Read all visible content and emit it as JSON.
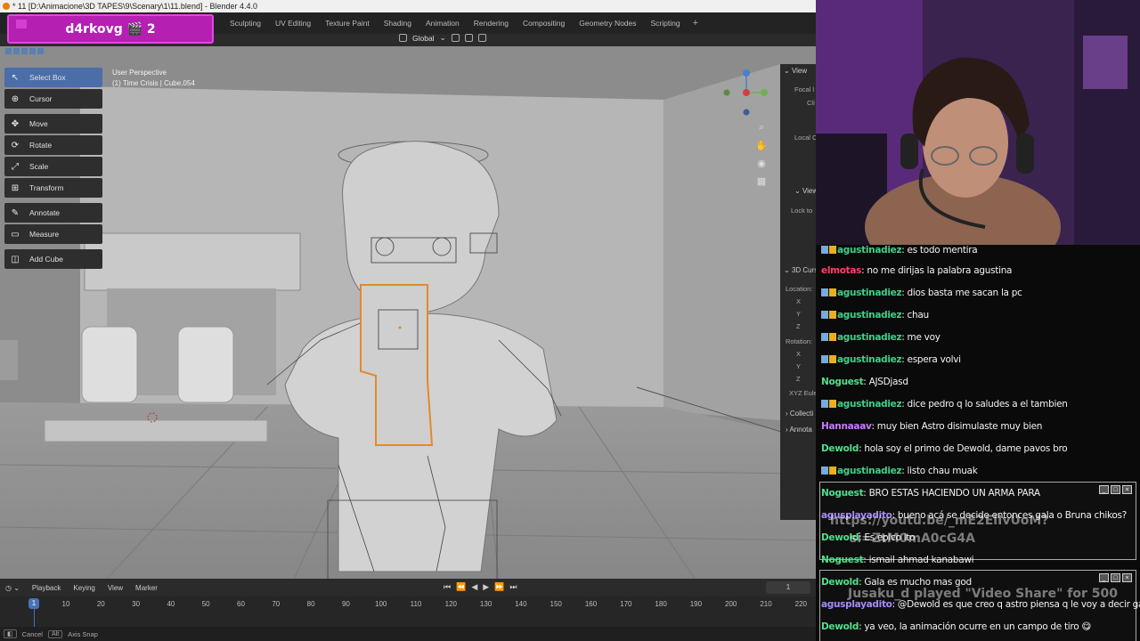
{
  "window": {
    "title": "* 11 [D:\\Animacione\\3D TAPES\\9\\Scenary\\1\\11.blend] - Blender 4.4.0"
  },
  "stream_banner": {
    "text": "d4rkovg 🎬 2"
  },
  "workspaces": [
    "Sculpting",
    "UV Editing",
    "Texture Paint",
    "Shading",
    "Animation",
    "Rendering",
    "Compositing",
    "Geometry Nodes",
    "Scripting"
  ],
  "workspace_add": "+",
  "header": {
    "orientation": "Global"
  },
  "viewport": {
    "perspective": "User Perspective",
    "object": "(1) Time Crisis | Cube.054"
  },
  "toolbar": {
    "items": [
      {
        "label": "Select Box",
        "icon": "cursor-arrow-icon",
        "glyph": "↖",
        "active": true
      },
      {
        "label": "Cursor",
        "icon": "3d-cursor-icon",
        "glyph": "⊕"
      },
      {
        "label": "Move",
        "icon": "move-icon",
        "glyph": "✥"
      },
      {
        "label": "Rotate",
        "icon": "rotate-icon",
        "glyph": "⟳"
      },
      {
        "label": "Scale",
        "icon": "scale-icon",
        "glyph": "⤢"
      },
      {
        "label": "Transform",
        "icon": "transform-icon",
        "glyph": "⊞"
      },
      {
        "label": "Annotate",
        "icon": "pencil-icon",
        "glyph": "✎"
      },
      {
        "label": "Measure",
        "icon": "ruler-icon",
        "glyph": "▭"
      },
      {
        "label": "Add Cube",
        "icon": "cube-icon",
        "glyph": "◫"
      }
    ]
  },
  "npanel": {
    "view_header": "View",
    "focal": "Focal l",
    "clip": "Cli",
    "local": "Local C",
    "view2": "View",
    "lock": "Lock to",
    "cursor3d": "3D Curs",
    "location": "Location:",
    "x": "X",
    "y": "Y",
    "z": "Z",
    "rotation": "Rotation:",
    "euler": "XYZ Eule",
    "collection": "Collecti",
    "annotations": "Annota"
  },
  "timeline": {
    "menus": [
      "Playback",
      "Keying",
      "View",
      "Marker"
    ],
    "current_frame": "1",
    "frame_display": "1",
    "ticks": [
      "10",
      "20",
      "30",
      "40",
      "50",
      "60",
      "70",
      "80",
      "90",
      "100",
      "110",
      "120",
      "130",
      "140",
      "150",
      "160",
      "170",
      "180",
      "190",
      "200",
      "210",
      "220"
    ]
  },
  "statusbar": {
    "cancel": "Cancel",
    "alt": "Alt",
    "snap": "Axis Snap"
  },
  "chat": {
    "messages": [
      {
        "user": "agustinadiez",
        "text": ": es todo mentira",
        "color": "#3fd18a",
        "badges": true
      },
      {
        "user": "elmotas",
        "text": ": no me dirijas la palabra agustina",
        "color": "#ff3f6a",
        "badges": false
      },
      {
        "user": "agustinadiez",
        "text": ": dios basta me sacan la pc",
        "color": "#3fd18a",
        "badges": true
      },
      {
        "user": "agustinadiez",
        "text": ": chau",
        "color": "#3fd18a",
        "badges": true
      },
      {
        "user": "agustinadiez",
        "text": ": me voy",
        "color": "#3fd18a",
        "badges": true
      },
      {
        "user": "agustinadiez",
        "text": ": espera volvi",
        "color": "#3fd18a",
        "badges": true
      },
      {
        "user": "Noguest",
        "text": ": AJSDjasd",
        "color": "#4fe08a",
        "badges": false
      },
      {
        "user": "agustinadiez",
        "text": ": dice pedro q lo saludes a el tambien",
        "color": "#3fd18a",
        "badges": true
      },
      {
        "user": "Hannaaav",
        "text": ": muy bien Astro disimulaste muy bien",
        "color": "#c97bff",
        "badges": false
      },
      {
        "user": "Dewold",
        "text": ": hola soy el primo de Dewold, dame pavos bro",
        "color": "#4fe08a",
        "badges": false
      },
      {
        "user": "agustinadiez",
        "text": ": listo chau muak",
        "color": "#3fd18a",
        "badges": true
      },
      {
        "user": "Noguest",
        "text": ": BRO ESTAS HACIENDO UN ARMA PARA",
        "color": "#4fe08a",
        "badges": false
      },
      {
        "user": "agusplayadito",
        "text": ": bueno acá se decide entonces gala o Bruna chikos?",
        "color": "#a78bfa",
        "badges": false
      },
      {
        "user": "Dewold",
        "text": ": Es epico ito",
        "color": "#4fe08a",
        "badges": false
      },
      {
        "user": "Noguest",
        "text": ": ismail ahmad kanabawi",
        "color": "#4fe08a",
        "badges": false
      },
      {
        "user": "Dewold",
        "text": ": Gala es mucho mas god",
        "color": "#4fe08a",
        "badges": false
      },
      {
        "user": "agusplayadito",
        "text": ": @Dewold es que creo q astro piensa q le voy a decir galati",
        "color": "#a78bfa",
        "badges": false
      },
      {
        "user": "Dewold",
        "text": ": ya veo, la animación ocurre en un campo de tiro 😋",
        "color": "#4fe08a",
        "badges": false
      }
    ],
    "overlay1": "https://youtu.be/_mE2ElIvUoM?",
    "overlay2": "si=ZtM0mA0cG4A",
    "overlay3": "Jusaku_d played \"Video Share\" for 500"
  }
}
